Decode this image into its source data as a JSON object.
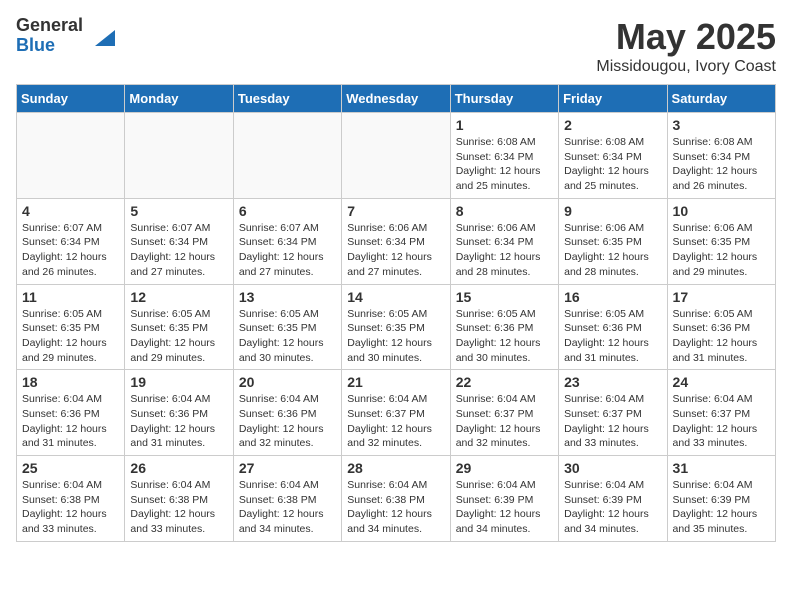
{
  "logo": {
    "general": "General",
    "blue": "Blue"
  },
  "title": "May 2025",
  "location": "Missidougou, Ivory Coast",
  "days_of_week": [
    "Sunday",
    "Monday",
    "Tuesday",
    "Wednesday",
    "Thursday",
    "Friday",
    "Saturday"
  ],
  "weeks": [
    [
      {
        "day": "",
        "info": ""
      },
      {
        "day": "",
        "info": ""
      },
      {
        "day": "",
        "info": ""
      },
      {
        "day": "",
        "info": ""
      },
      {
        "day": "1",
        "info": "Sunrise: 6:08 AM\nSunset: 6:34 PM\nDaylight: 12 hours and 25 minutes."
      },
      {
        "day": "2",
        "info": "Sunrise: 6:08 AM\nSunset: 6:34 PM\nDaylight: 12 hours and 25 minutes."
      },
      {
        "day": "3",
        "info": "Sunrise: 6:08 AM\nSunset: 6:34 PM\nDaylight: 12 hours and 26 minutes."
      }
    ],
    [
      {
        "day": "4",
        "info": "Sunrise: 6:07 AM\nSunset: 6:34 PM\nDaylight: 12 hours and 26 minutes."
      },
      {
        "day": "5",
        "info": "Sunrise: 6:07 AM\nSunset: 6:34 PM\nDaylight: 12 hours and 27 minutes."
      },
      {
        "day": "6",
        "info": "Sunrise: 6:07 AM\nSunset: 6:34 PM\nDaylight: 12 hours and 27 minutes."
      },
      {
        "day": "7",
        "info": "Sunrise: 6:06 AM\nSunset: 6:34 PM\nDaylight: 12 hours and 27 minutes."
      },
      {
        "day": "8",
        "info": "Sunrise: 6:06 AM\nSunset: 6:34 PM\nDaylight: 12 hours and 28 minutes."
      },
      {
        "day": "9",
        "info": "Sunrise: 6:06 AM\nSunset: 6:35 PM\nDaylight: 12 hours and 28 minutes."
      },
      {
        "day": "10",
        "info": "Sunrise: 6:06 AM\nSunset: 6:35 PM\nDaylight: 12 hours and 29 minutes."
      }
    ],
    [
      {
        "day": "11",
        "info": "Sunrise: 6:05 AM\nSunset: 6:35 PM\nDaylight: 12 hours and 29 minutes."
      },
      {
        "day": "12",
        "info": "Sunrise: 6:05 AM\nSunset: 6:35 PM\nDaylight: 12 hours and 29 minutes."
      },
      {
        "day": "13",
        "info": "Sunrise: 6:05 AM\nSunset: 6:35 PM\nDaylight: 12 hours and 30 minutes."
      },
      {
        "day": "14",
        "info": "Sunrise: 6:05 AM\nSunset: 6:35 PM\nDaylight: 12 hours and 30 minutes."
      },
      {
        "day": "15",
        "info": "Sunrise: 6:05 AM\nSunset: 6:36 PM\nDaylight: 12 hours and 30 minutes."
      },
      {
        "day": "16",
        "info": "Sunrise: 6:05 AM\nSunset: 6:36 PM\nDaylight: 12 hours and 31 minutes."
      },
      {
        "day": "17",
        "info": "Sunrise: 6:05 AM\nSunset: 6:36 PM\nDaylight: 12 hours and 31 minutes."
      }
    ],
    [
      {
        "day": "18",
        "info": "Sunrise: 6:04 AM\nSunset: 6:36 PM\nDaylight: 12 hours and 31 minutes."
      },
      {
        "day": "19",
        "info": "Sunrise: 6:04 AM\nSunset: 6:36 PM\nDaylight: 12 hours and 31 minutes."
      },
      {
        "day": "20",
        "info": "Sunrise: 6:04 AM\nSunset: 6:36 PM\nDaylight: 12 hours and 32 minutes."
      },
      {
        "day": "21",
        "info": "Sunrise: 6:04 AM\nSunset: 6:37 PM\nDaylight: 12 hours and 32 minutes."
      },
      {
        "day": "22",
        "info": "Sunrise: 6:04 AM\nSunset: 6:37 PM\nDaylight: 12 hours and 32 minutes."
      },
      {
        "day": "23",
        "info": "Sunrise: 6:04 AM\nSunset: 6:37 PM\nDaylight: 12 hours and 33 minutes."
      },
      {
        "day": "24",
        "info": "Sunrise: 6:04 AM\nSunset: 6:37 PM\nDaylight: 12 hours and 33 minutes."
      }
    ],
    [
      {
        "day": "25",
        "info": "Sunrise: 6:04 AM\nSunset: 6:38 PM\nDaylight: 12 hours and 33 minutes."
      },
      {
        "day": "26",
        "info": "Sunrise: 6:04 AM\nSunset: 6:38 PM\nDaylight: 12 hours and 33 minutes."
      },
      {
        "day": "27",
        "info": "Sunrise: 6:04 AM\nSunset: 6:38 PM\nDaylight: 12 hours and 34 minutes."
      },
      {
        "day": "28",
        "info": "Sunrise: 6:04 AM\nSunset: 6:38 PM\nDaylight: 12 hours and 34 minutes."
      },
      {
        "day": "29",
        "info": "Sunrise: 6:04 AM\nSunset: 6:39 PM\nDaylight: 12 hours and 34 minutes."
      },
      {
        "day": "30",
        "info": "Sunrise: 6:04 AM\nSunset: 6:39 PM\nDaylight: 12 hours and 34 minutes."
      },
      {
        "day": "31",
        "info": "Sunrise: 6:04 AM\nSunset: 6:39 PM\nDaylight: 12 hours and 35 minutes."
      }
    ]
  ]
}
